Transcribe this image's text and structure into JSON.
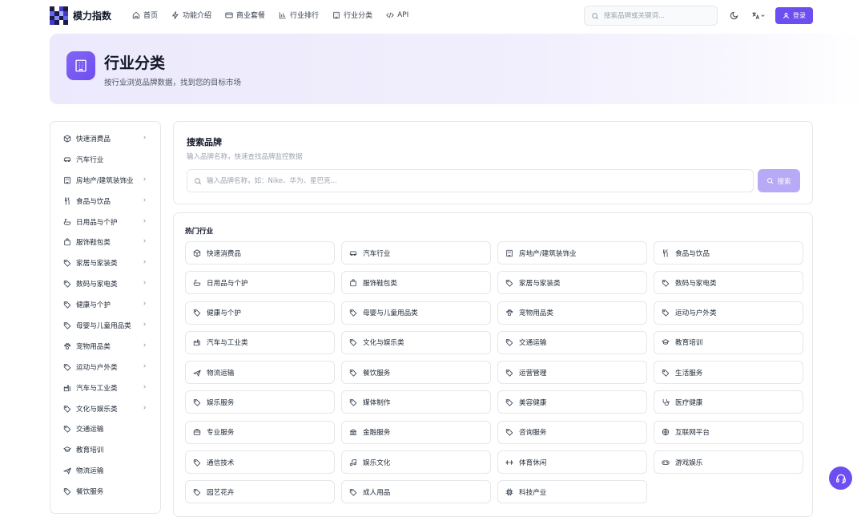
{
  "brand": {
    "name": "模力指数",
    "accent": "#6d4ef0"
  },
  "nav": [
    {
      "label": "首页",
      "icon": "home-icon"
    },
    {
      "label": "功能介绍",
      "icon": "bolt-icon"
    },
    {
      "label": "商业套餐",
      "icon": "card-icon"
    },
    {
      "label": "行业排行",
      "icon": "bar-chart-icon"
    },
    {
      "label": "行业分类",
      "icon": "building-icon"
    },
    {
      "label": "API",
      "icon": "code-icon"
    }
  ],
  "top_search": {
    "placeholder": "搜索品牌或关键词..."
  },
  "login_label": "登录",
  "banner": {
    "title": "行业分类",
    "subtitle": "按行业浏览品牌数据，找到您的目标市场"
  },
  "sidebar": {
    "items": [
      {
        "label": "快速消费品",
        "icon": "box-icon",
        "has_children": true
      },
      {
        "label": "汽车行业",
        "icon": "car-icon",
        "has_children": false
      },
      {
        "label": "房地产/建筑装饰业",
        "icon": "building-icon",
        "has_children": true
      },
      {
        "label": "食品与饮品",
        "icon": "utensils-icon",
        "has_children": true
      },
      {
        "label": "日用品与个护",
        "icon": "bath-icon",
        "has_children": true
      },
      {
        "label": "服饰鞋包类",
        "icon": "bag-icon",
        "has_children": true
      },
      {
        "label": "家居与家装类",
        "icon": "tag-icon",
        "has_children": true
      },
      {
        "label": "数码与家电类",
        "icon": "tag-icon",
        "has_children": true
      },
      {
        "label": "健康与个护",
        "icon": "tag-icon",
        "has_children": true
      },
      {
        "label": "母婴与儿童用品类",
        "icon": "tag-icon",
        "has_children": true
      },
      {
        "label": "宠物用品类",
        "icon": "paw-icon",
        "has_children": true
      },
      {
        "label": "运动与户外类",
        "icon": "tag-icon",
        "has_children": true
      },
      {
        "label": "汽车与工业类",
        "icon": "factory-icon",
        "has_children": true
      },
      {
        "label": "文化与娱乐类",
        "icon": "tag-icon",
        "has_children": true
      },
      {
        "label": "交通运输",
        "icon": "tag-icon",
        "has_children": false
      },
      {
        "label": "教育培训",
        "icon": "graduation-cap-icon",
        "has_children": false
      },
      {
        "label": "物流运输",
        "icon": "plane-icon",
        "has_children": false
      },
      {
        "label": "餐饮服务",
        "icon": "tag-icon",
        "has_children": false
      }
    ]
  },
  "search_card": {
    "title": "搜索品牌",
    "subtitle": "输入品牌名称，快速查找品牌监控数据",
    "placeholder": "输入品牌名称，如：Nike、华为、星巴克...",
    "button_label": "搜索"
  },
  "hot": {
    "title": "热门行业",
    "items": [
      {
        "label": "快速消费品",
        "icon": "box-icon"
      },
      {
        "label": "汽车行业",
        "icon": "car-icon"
      },
      {
        "label": "房地产/建筑装饰业",
        "icon": "building-icon"
      },
      {
        "label": "食品与饮品",
        "icon": "utensils-icon"
      },
      {
        "label": "日用品与个护",
        "icon": "bath-icon"
      },
      {
        "label": "服饰鞋包类",
        "icon": "bag-icon"
      },
      {
        "label": "家居与家装类",
        "icon": "tag-icon"
      },
      {
        "label": "数码与家电类",
        "icon": "tag-icon"
      },
      {
        "label": "健康与个护",
        "icon": "tag-icon"
      },
      {
        "label": "母婴与儿童用品类",
        "icon": "tag-icon"
      },
      {
        "label": "宠物用品类",
        "icon": "paw-icon"
      },
      {
        "label": "运动与户外类",
        "icon": "tag-icon"
      },
      {
        "label": "汽车与工业类",
        "icon": "factory-icon"
      },
      {
        "label": "文化与娱乐类",
        "icon": "tag-icon"
      },
      {
        "label": "交通运输",
        "icon": "tag-icon"
      },
      {
        "label": "教育培训",
        "icon": "graduation-cap-icon"
      },
      {
        "label": "物流运输",
        "icon": "plane-icon"
      },
      {
        "label": "餐饮服务",
        "icon": "tag-icon"
      },
      {
        "label": "运营管理",
        "icon": "tag-icon"
      },
      {
        "label": "生活服务",
        "icon": "tag-icon"
      },
      {
        "label": "娱乐服务",
        "icon": "tag-icon"
      },
      {
        "label": "媒体制作",
        "icon": "tag-icon"
      },
      {
        "label": "美容健康",
        "icon": "tag-icon"
      },
      {
        "label": "医疗健康",
        "icon": "stethoscope-icon"
      },
      {
        "label": "专业服务",
        "icon": "briefcase-icon"
      },
      {
        "label": "金融服务",
        "icon": "bank-icon"
      },
      {
        "label": "咨询服务",
        "icon": "tag-icon"
      },
      {
        "label": "互联网平台",
        "icon": "globe-icon"
      },
      {
        "label": "通信技术",
        "icon": "tag-icon"
      },
      {
        "label": "娱乐文化",
        "icon": "music-icon"
      },
      {
        "label": "体育休闲",
        "icon": "dumbbell-icon"
      },
      {
        "label": "游戏娱乐",
        "icon": "gamepad-icon"
      },
      {
        "label": "园艺花卉",
        "icon": "tag-icon"
      },
      {
        "label": "成人用品",
        "icon": "tag-icon"
      },
      {
        "label": "科技产业",
        "icon": "chip-icon"
      }
    ]
  }
}
